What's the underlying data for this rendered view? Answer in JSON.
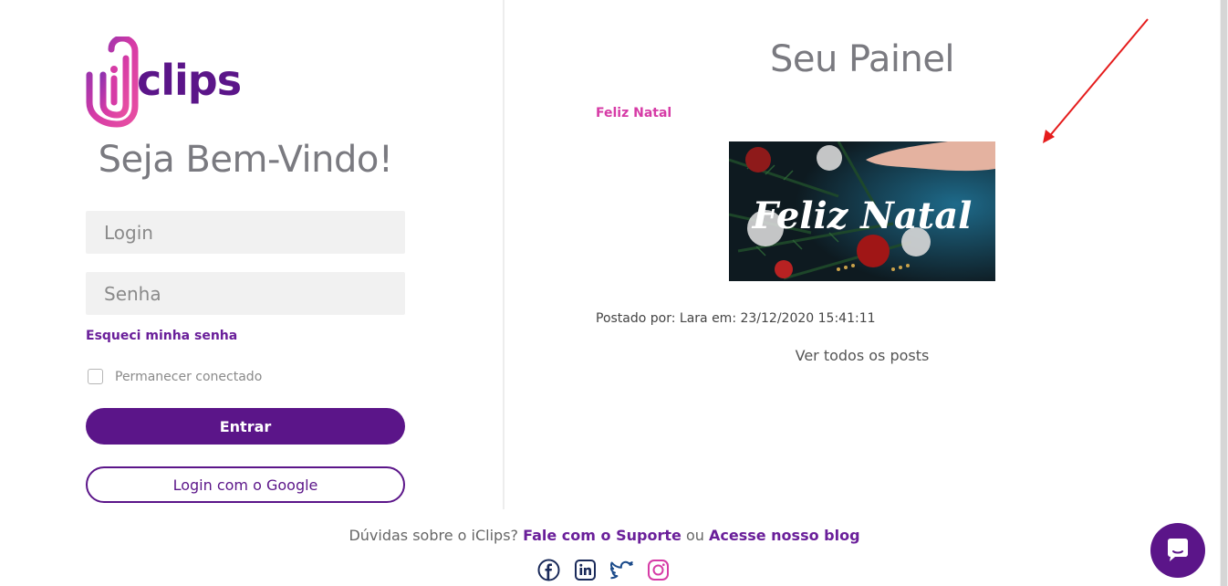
{
  "login": {
    "logo_text": "iclips",
    "welcome": "Seja Bem-Vindo!",
    "login_placeholder": "Login",
    "password_placeholder": "Senha",
    "forgot_password": "Esqueci minha senha",
    "remember_me": "Permanecer conectado",
    "enter_button": "Entrar",
    "google_button": "Login com o Google"
  },
  "panel": {
    "title": "Seu Painel",
    "post": {
      "title": "Feliz Natal",
      "image_caption": "Feliz Natal",
      "meta": "Postado por: Lara em: 23/12/2020 15:41:11"
    },
    "view_all": "Ver todos os posts"
  },
  "footer": {
    "question": "Dúvidas sobre o iClips?",
    "support_link": "Fale com o Suporte",
    "or": "ou",
    "blog_link": "Acesse nosso blog",
    "social": [
      "facebook-icon",
      "linkedin-icon",
      "twitter-icon",
      "instagram-icon"
    ]
  },
  "colors": {
    "brand_purple": "#5b1589",
    "brand_pink": "#d63ba6",
    "annotation_red": "#e51c1c"
  }
}
